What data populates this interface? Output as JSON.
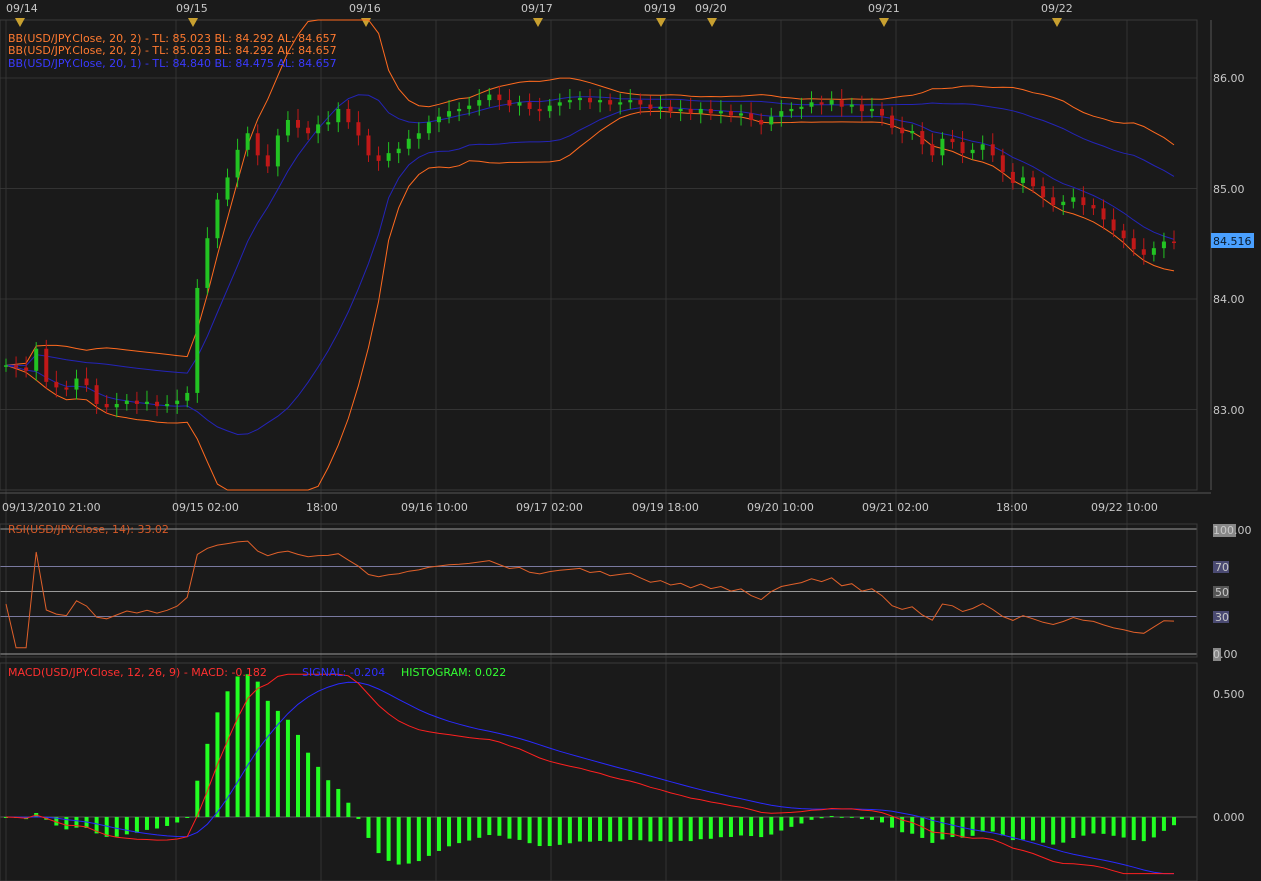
{
  "window": {
    "date_markers": [
      "09/14",
      "09/15",
      "09/16",
      "09/17",
      "09/19",
      "09/20",
      "09/21",
      "09/22"
    ],
    "time_ticks": [
      "09/13/2010 21:00",
      "09/15 02:00",
      "18:00",
      "09/16 10:00",
      "09/17 02:00",
      "09/19 18:00",
      "09/20 10:00",
      "09/21 02:00",
      "18:00",
      "09/22 10:00"
    ]
  },
  "price_panel": {
    "legend": [
      {
        "text": "BB(USD/JPY.Close, 20, 2) -  TL: 85.023  BL: 84.292  AL: 84.657",
        "color": "#ff7a30"
      },
      {
        "text": "BB(USD/JPY.Close, 20, 2) -  TL: 85.023  BL: 84.292  AL: 84.657",
        "color": "#ff7a30"
      },
      {
        "text": "BB(USD/JPY.Close, 20, 1) -  TL: 84.840  BL: 84.475  AL: 84.657",
        "color": "#3a3aff"
      }
    ],
    "y_ticks": [
      "86.00",
      "85.00",
      "84.00",
      "83.00"
    ],
    "current_price": "84.516"
  },
  "rsi_panel": {
    "title": "RSI(USD/JPY.Close, 14): 33.02",
    "y_ticks": [
      "100.00",
      "0.00"
    ],
    "level_labels": [
      "70",
      "50",
      "30"
    ]
  },
  "macd_panel": {
    "title_parts": [
      {
        "text": "MACD(USD/JPY.Close, 12, 26, 9) -  MACD: -0.182",
        "color": "#ff3030"
      },
      {
        "text": "SIGNAL: -0.204",
        "color": "#3030ff"
      },
      {
        "text": "HISTOGRAM: 0.022",
        "color": "#33ff33"
      }
    ],
    "y_ticks": [
      "0.500",
      "0.000"
    ]
  },
  "colors": {
    "bg": "#1a1a1a",
    "up": "#22c322",
    "down": "#c01818",
    "bb2": "#ff6a1f",
    "bb1": "#2424b8",
    "rsi": "#e0602a",
    "macd": "#ff2020",
    "signal": "#2a2aff",
    "hist": "#22ff22",
    "price_tag": "#4aa0ff"
  },
  "chart_data": [
    {
      "type": "candlestick",
      "title": "",
      "ylim": [
        82.3,
        86.6
      ],
      "x_start": "09/13/2010 21:00",
      "bar_interval_hours": 2,
      "close": [
        83.4,
        83.38,
        83.35,
        83.55,
        83.25,
        83.2,
        83.18,
        83.28,
        83.22,
        83.05,
        83.02,
        83.05,
        83.08,
        83.05,
        83.07,
        83.03,
        83.05,
        83.08,
        83.15,
        84.1,
        84.55,
        84.9,
        85.1,
        85.35,
        85.5,
        85.3,
        85.2,
        85.48,
        85.62,
        85.55,
        85.5,
        85.58,
        85.6,
        85.72,
        85.6,
        85.48,
        85.3,
        85.25,
        85.32,
        85.36,
        85.45,
        85.5,
        85.6,
        85.65,
        85.7,
        85.72,
        85.75,
        85.8,
        85.85,
        85.8,
        85.75,
        85.78,
        85.72,
        85.7,
        85.75,
        85.78,
        85.8,
        85.82,
        85.78,
        85.8,
        85.76,
        85.78,
        85.8,
        85.76,
        85.72,
        85.74,
        85.7,
        85.72,
        85.68,
        85.72,
        85.68,
        85.7,
        85.66,
        85.68,
        85.62,
        85.58,
        85.65,
        85.7,
        85.72,
        85.74,
        85.78,
        85.76,
        85.8,
        85.74,
        85.76,
        85.7,
        85.72,
        85.66,
        85.55,
        85.5,
        85.52,
        85.4,
        85.3,
        85.45,
        85.42,
        85.32,
        85.35,
        85.4,
        85.3,
        85.15,
        85.05,
        85.1,
        85.02,
        84.92,
        84.85,
        84.88,
        84.92,
        84.85,
        84.82,
        84.72,
        84.62,
        84.55,
        84.45,
        84.4,
        84.46,
        84.52,
        84.51
      ]
    },
    {
      "type": "line",
      "title": "RSI(USD/JPY.Close, 14)",
      "ylim": [
        0,
        100
      ],
      "levels": [
        70,
        50,
        30
      ]
    },
    {
      "type": "bar",
      "title": "MACD(USD/JPY.Close, 12, 26, 9)",
      "series": [
        {
          "name": "MACD"
        },
        {
          "name": "SIGNAL"
        },
        {
          "name": "HISTOGRAM"
        }
      ],
      "ylim": [
        -0.5,
        0.7
      ]
    }
  ]
}
